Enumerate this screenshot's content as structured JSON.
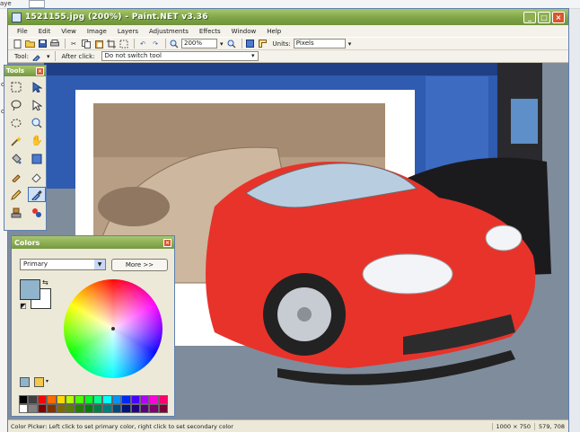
{
  "background": {
    "left_fragment": "aye",
    "side_labels": [
      "ou",
      "ou"
    ]
  },
  "window": {
    "title": "1521155.jpg (200%) - Paint.NET v3.36",
    "buttons": {
      "minimize": "_",
      "maximize": "□",
      "close": "×"
    }
  },
  "menu": [
    "File",
    "Edit",
    "View",
    "Image",
    "Layers",
    "Adjustments",
    "Effects",
    "Window",
    "Help"
  ],
  "toolbar": {
    "zoom": "200%",
    "units_label": "Units:",
    "units_value": "Pixels"
  },
  "toolbar2": {
    "tool_label": "Tool:",
    "after_click_label": "After click:",
    "after_click_value": "Do not switch tool"
  },
  "tools_panel": {
    "title": "Tools",
    "close": "×"
  },
  "colors_panel": {
    "title": "Colors",
    "close": "×",
    "mode": "Primary",
    "more_button": "More >>"
  },
  "colors": {
    "primary": "#8fb4cb",
    "secondary": "#ffffff",
    "car": "#e8332b",
    "titlebar": "#8fb04f"
  },
  "palette": [
    "#000000",
    "#404040",
    "#ff0000",
    "#ff6a00",
    "#ffd800",
    "#b6ff00",
    "#4cff00",
    "#00ff21",
    "#00ff90",
    "#00ffff",
    "#0094ff",
    "#0026ff",
    "#4800ff",
    "#b200ff",
    "#ff00dc",
    "#ff006e",
    "#ffffff",
    "#808080",
    "#7f0000",
    "#7f3300",
    "#7f6a00",
    "#5b7f00",
    "#267f00",
    "#007f0e",
    "#007f46",
    "#007f7f",
    "#004a7f",
    "#00137f",
    "#21007f",
    "#57007f",
    "#7f006e",
    "#7f0037"
  ],
  "status": {
    "hint": "Color Picker: Left click to set primary color, right click to set secondary color",
    "image_size": "1000 × 750",
    "cursor": "579, 708"
  }
}
